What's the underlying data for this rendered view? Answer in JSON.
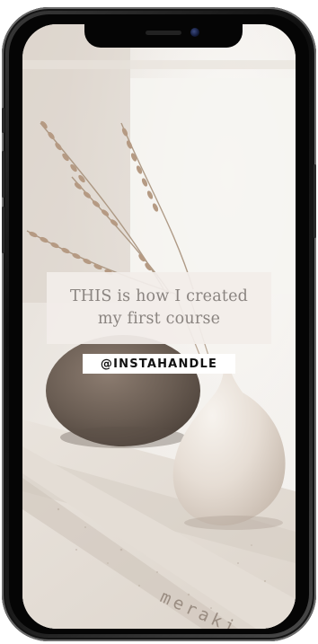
{
  "post": {
    "headline": "THIS is how I created\nmy first course",
    "handle": "@INSTAHANDLE",
    "tray_engraving": "meraki"
  },
  "colors": {
    "headline_box": "#f2ede9",
    "headline_text": "#8a8480",
    "handle_box": "#ffffff",
    "handle_text": "#111111",
    "phone_frame": "#111111"
  },
  "icons": {
    "camera": "front-camera-icon",
    "speaker": "earpiece-speaker-icon"
  }
}
